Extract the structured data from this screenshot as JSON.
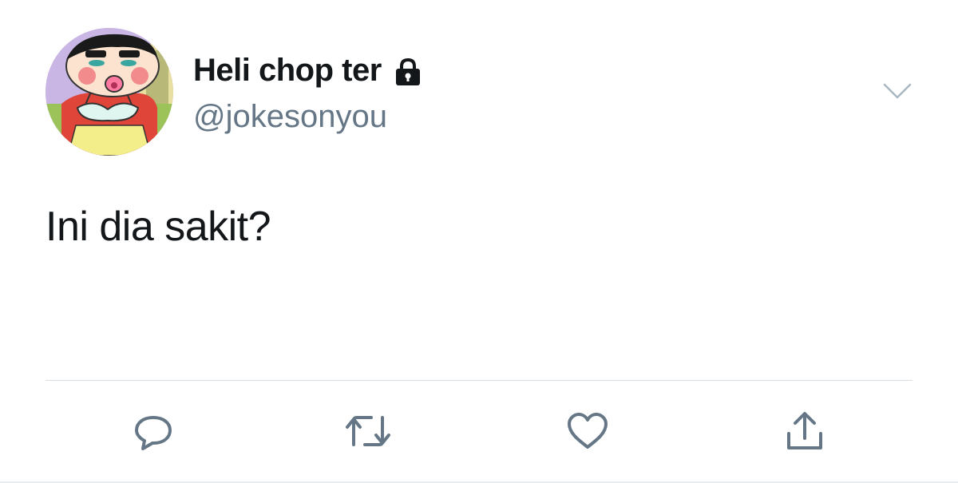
{
  "tweet": {
    "display_name": "Heli chop ter",
    "handle": "@jokesonyou",
    "text": "Ini dia sakit?",
    "protected_icon": "lock-icon",
    "menu_icon": "chevron-down-icon"
  },
  "actions": [
    {
      "name": "reply",
      "icon": "reply-icon"
    },
    {
      "name": "retweet",
      "icon": "retweet-icon"
    },
    {
      "name": "like",
      "icon": "heart-icon"
    },
    {
      "name": "share",
      "icon": "share-icon"
    }
  ],
  "colors": {
    "text": "#14171a",
    "secondary": "#657786",
    "icon": "#657786",
    "divider": "#d6dde3"
  }
}
